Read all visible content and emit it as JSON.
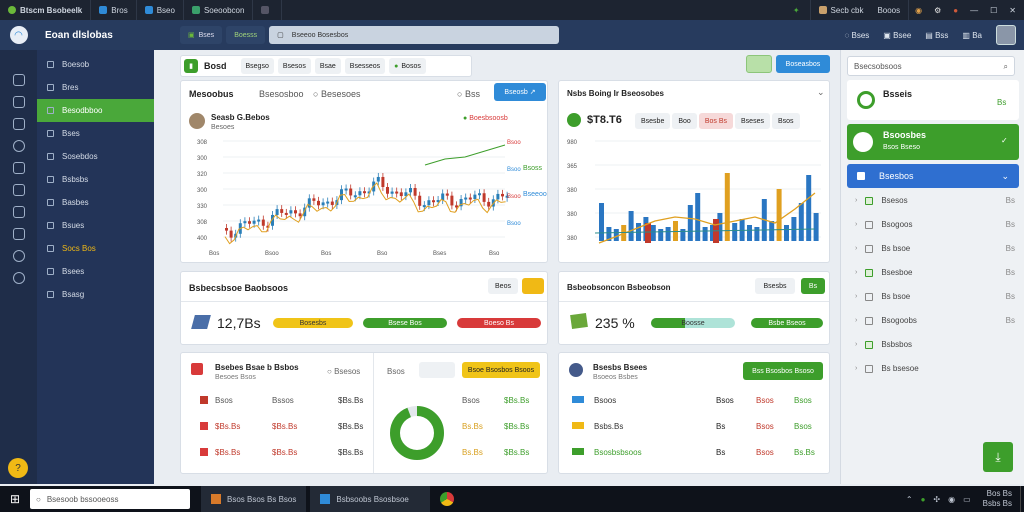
{
  "titlebar": {
    "app_name": "Btscm Bsobeelk",
    "tabs": [
      "Bros",
      "Bseo",
      "Soeoobcon",
      ""
    ],
    "right_label": "Secb cbk",
    "right_label2": "Booos"
  },
  "header": {
    "brand": "Eoan dlslobas",
    "search_tab_1": "Bses",
    "search_tab_2": "Boesss",
    "search_value": "Bseeoo Bosesbos",
    "right_1": "Bses",
    "right_2": "Bsee",
    "right_3": "Bss",
    "right_4": "Ba"
  },
  "menu": [
    {
      "label": "Boesob",
      "active": false
    },
    {
      "label": "Bres",
      "active": false
    },
    {
      "label": "Besodbboo",
      "active": true
    },
    {
      "label": "Bses",
      "active": false
    },
    {
      "label": "Sosebdos",
      "active": false
    },
    {
      "label": "Bsbsbs",
      "active": false
    },
    {
      "label": "Basbes",
      "active": false
    },
    {
      "label": "Bsues",
      "active": false
    },
    {
      "label": "Socs Bos",
      "active": false,
      "highlight": true
    },
    {
      "label": "Bsees",
      "active": false
    },
    {
      "label": "Bsasg",
      "active": false
    }
  ],
  "toolbar": {
    "home_label": "Bosd",
    "tabs": [
      "Bsegso",
      "Bsesos",
      "Bsae",
      "Bsesseos",
      "Bosos"
    ],
    "btn_grey": "",
    "btn_blue": "Boseasbos"
  },
  "card1": {
    "title": "Mesoobus",
    "tabs": [
      "Bsesosboo",
      "Besesoes"
    ],
    "sel": "Bss",
    "btn": "Bseosb",
    "subtitle": "Seasb G.Bebos",
    "sub2": "Besoes",
    "legend": [
      "Boesbsoosb",
      "Bsoss",
      "Bseeoo"
    ],
    "y_left": [
      "308",
      "300",
      "320",
      "300",
      "330",
      "308",
      "400"
    ],
    "x_labels": [
      "Bos",
      "Bsoo",
      "Bos",
      "Bso",
      "Bses",
      "Bso"
    ],
    "y_right": [
      "Bsoo",
      "Bsoo",
      "Bsoo",
      "Bsoo"
    ]
  },
  "card2": {
    "title": "Nsbs Boing Ir Bseosobes",
    "value": "$T8.T6",
    "chips": [
      "Bsesbe",
      "Boo",
      "Bos Bs",
      "Bseses",
      "Bsos"
    ],
    "y_left": [
      "980",
      "365",
      "380",
      "380",
      "380"
    ],
    "x_labels": [
      "Bs",
      "Bo",
      "Bs",
      "Bs",
      "Bs",
      "Bs",
      "Bs",
      "Bo",
      "Bs"
    ]
  },
  "card3": {
    "title": "Bsbecsbsoe Baobsoos",
    "grey": "Beos",
    "yellow": "",
    "value": "12,7Bs",
    "pill_y": "Bosesbs",
    "pill_g": "Bsese Bos",
    "pill_r": "Boeso Bs"
  },
  "card4": {
    "title": "Bsbeobsoncon Bsbeobson",
    "grey": "Bsesbs",
    "green": "Bs",
    "value": "235 %",
    "pill_t": "Boosse",
    "pill_g": "Bsbe Bseos"
  },
  "card5": {
    "title": "Bsebes Bsae b Bsbos",
    "sub": "Besoes Bsos",
    "tab_a": "Bsesos",
    "tab_b": "Bsos",
    "tab_c": "Bsoe Bsosbos Bsoos",
    "rows": [
      [
        "Bsos",
        "Bssos",
        "$Bs.Bs"
      ],
      [
        "$Bs.Bs",
        "$Bs.Bs",
        "$Bs.Bs"
      ],
      [
        "$Bs.Bs",
        "$Bs.Bs",
        "$Bs.Bs"
      ]
    ],
    "right_rows": [
      [
        "Bsos",
        "$Bs.Bs"
      ],
      [
        "Bs.Bs",
        "$Bs.Bs"
      ],
      [
        "Bs.Bs",
        "$Bs.Bs"
      ]
    ]
  },
  "card6": {
    "title": "Bsesbs Bsees",
    "sub": "Bsoeos Bsbes",
    "btn": "Bss Bsosbos Bsoso",
    "rows": [
      [
        "Bsoos",
        "Bsos",
        "Bsos",
        "Bsos"
      ],
      [
        "Bsbs.Bs",
        "Bs",
        "Bsos",
        "Bsos"
      ],
      [
        "Bsosbsbsoos",
        "Bs",
        "Bsos",
        "Bs.Bs"
      ]
    ]
  },
  "right": {
    "search": "Bsecsobsoos",
    "item1": "Bsseis",
    "item1_val": "Bs",
    "item2": "Bsoosbes",
    "item2_sub": "Bsos Bseso",
    "item3": "Bsesbos",
    "tree": [
      {
        "label": "Bsesos",
        "val": "Bs"
      },
      {
        "label": "Bsogoos",
        "val": "Bs"
      },
      {
        "label": "Bs bsoe",
        "val": "Bs"
      },
      {
        "label": "Bsesboe",
        "val": "Bs"
      },
      {
        "label": "Bs bsoe",
        "val": "Bs"
      },
      {
        "label": "Bsogoobs",
        "val": "Bs"
      },
      {
        "label": "Bsbsbos",
        "val": ""
      },
      {
        "label": "Bs bsesoe",
        "val": ""
      }
    ]
  },
  "taskbar": {
    "search": "Bsesoob bssooeoss",
    "app1": "Bsos Bsos Bs Bsos",
    "app2": "Bsbsoobs Bsosbsoe",
    "clock": "Bos Bs",
    "date": "Bsbs Bs"
  },
  "colors": {
    "green": "#3d9e2b",
    "blue": "#2f8bd8",
    "red": "#d83a3a",
    "yellow": "#f0b915",
    "navy": "#233458"
  }
}
